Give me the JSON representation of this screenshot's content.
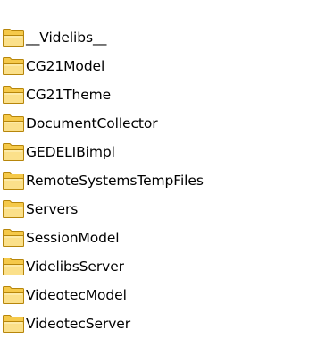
{
  "folders": [
    {
      "label": "__Videlibs__",
      "selected": false
    },
    {
      "label": "CG21Model",
      "selected": false
    },
    {
      "label": "CG21Theme",
      "selected": false
    },
    {
      "label": "DocumentCollector",
      "selected": false
    },
    {
      "label": "GEDELIBimpl",
      "selected": false
    },
    {
      "label": "RemoteSystemsTempFiles",
      "selected": false
    },
    {
      "label": "Servers",
      "selected": false
    },
    {
      "label": "SessionModel",
      "selected": false
    },
    {
      "label": "VidelibsServer",
      "selected": false
    },
    {
      "label": "VideotecModel",
      "selected": false
    },
    {
      "label": "VideotecServer",
      "selected": false
    }
  ],
  "icon": "folder-icon",
  "colors": {
    "folder_body": "#f5c94a",
    "folder_front": "#fbe08a",
    "folder_outline": "#b7860b",
    "text": "#000000",
    "background": "#ffffff"
  }
}
